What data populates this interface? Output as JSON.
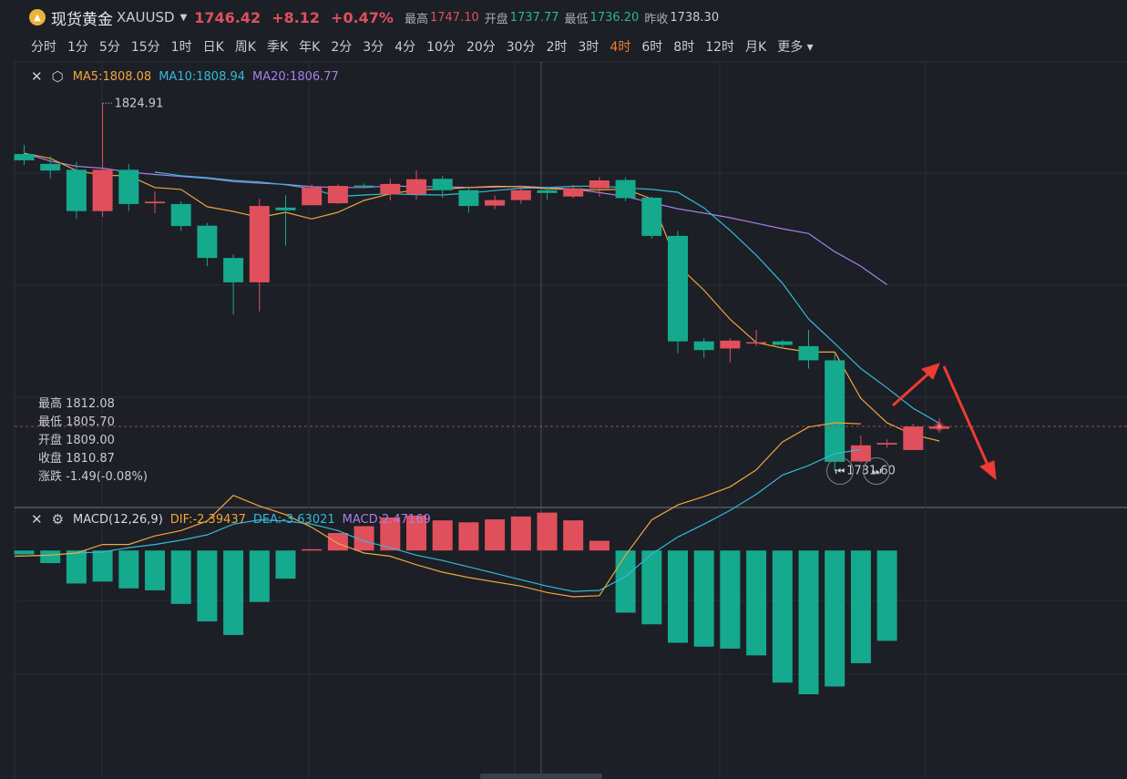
{
  "header": {
    "name": "现货黄金",
    "symbol": "XAUUSD",
    "price": "1746.42",
    "change": "+8.12",
    "change_pct": "+0.47%",
    "high_label": "最高",
    "high": "1747.10",
    "open_label": "开盘",
    "open": "1737.77",
    "low_label": "最低",
    "low": "1736.20",
    "prev_label": "昨收",
    "prev": "1738.30"
  },
  "periods": [
    "分时",
    "1分",
    "5分",
    "15分",
    "1时",
    "日K",
    "周K",
    "季K",
    "年K",
    "2分",
    "3分",
    "4分",
    "10分",
    "20分",
    "30分",
    "2时",
    "3时",
    "4时",
    "6时",
    "8时",
    "12时",
    "月K",
    "更多"
  ],
  "active_period": "4时",
  "legend": {
    "ma5": "MA5:1808.08",
    "ma10": "MA10:1808.94",
    "ma20": "MA20:1806.77",
    "macd_title": "MACD(12,26,9)",
    "dif": "DIF:-2.39437",
    "dea": "DEA:-3.63021",
    "macd": "MACD:2.47169"
  },
  "ohlc_info": {
    "high": "最高 1812.08",
    "low": "最低 1805.70",
    "open": "开盘 1809.00",
    "close": "收盘 1810.87",
    "change": "涨跌 -1.49(-0.08%)"
  },
  "colors": {
    "up": "#e0505c",
    "down": "#15a98e",
    "ma5": "#f2a43c",
    "ma10": "#35b9d6",
    "ma20": "#a77fe6",
    "arrow": "#ee3b34"
  },
  "icons": {
    "close": "close-icon",
    "settings": "gear-icon",
    "prev": "skip-back-icon",
    "next": "skip-forward-icon"
  },
  "chart_data": [
    {
      "type": "candlestick",
      "title": "",
      "ylim": [
        1726.6,
        1830.3
      ],
      "annotations": [
        {
          "text": "1824.91",
          "value": 1824.91,
          "index": 3
        },
        {
          "text": "1731.60",
          "value": 1731.6,
          "index": 31
        }
      ],
      "candles": [
        {
          "o": 1812.0,
          "c": 1810.4,
          "h": 1814.3,
          "l": 1809.2
        },
        {
          "o": 1809.5,
          "c": 1807.8,
          "h": 1811.5,
          "l": 1805.8
        },
        {
          "o": 1808.0,
          "c": 1797.5,
          "h": 1810.0,
          "l": 1795.5
        },
        {
          "o": 1797.5,
          "c": 1808.0,
          "h": 1824.91,
          "l": 1796.0
        },
        {
          "o": 1808.0,
          "c": 1799.3,
          "h": 1809.5,
          "l": 1797.5
        },
        {
          "o": 1799.5,
          "c": 1799.9,
          "h": 1802.5,
          "l": 1797.0
        },
        {
          "o": 1799.3,
          "c": 1793.7,
          "h": 1800.0,
          "l": 1792.5
        },
        {
          "o": 1793.8,
          "c": 1785.6,
          "h": 1794.5,
          "l": 1783.5
        },
        {
          "o": 1785.6,
          "c": 1779.4,
          "h": 1786.5,
          "l": 1771.2
        },
        {
          "o": 1779.4,
          "c": 1798.8,
          "h": 1800.6,
          "l": 1772.0
        },
        {
          "o": 1798.4,
          "c": 1797.7,
          "h": 1801.5,
          "l": 1788.7
        },
        {
          "o": 1799.0,
          "c": 1803.5,
          "h": 1804.3,
          "l": 1799.0
        },
        {
          "o": 1799.5,
          "c": 1803.9,
          "h": 1804.3,
          "l": 1799.3
        },
        {
          "o": 1804.0,
          "c": 1803.9,
          "h": 1804.5,
          "l": 1803.3
        },
        {
          "o": 1801.8,
          "c": 1804.4,
          "h": 1805.7,
          "l": 1800.2
        },
        {
          "o": 1801.8,
          "c": 1805.6,
          "h": 1807.9,
          "l": 1800.4
        },
        {
          "o": 1805.7,
          "c": 1802.8,
          "h": 1806.5,
          "l": 1800.9
        },
        {
          "o": 1802.8,
          "c": 1798.8,
          "h": 1803.5,
          "l": 1797.1
        },
        {
          "o": 1798.9,
          "c": 1800.3,
          "h": 1801.5,
          "l": 1798.0
        },
        {
          "o": 1800.3,
          "c": 1802.8,
          "h": 1804.0,
          "l": 1799.4
        },
        {
          "o": 1802.8,
          "c": 1802.1,
          "h": 1803.8,
          "l": 1800.4
        },
        {
          "o": 1801.2,
          "c": 1803.3,
          "h": 1804.2,
          "l": 1800.8
        },
        {
          "o": 1803.3,
          "c": 1805.3,
          "h": 1806.1,
          "l": 1801.2
        },
        {
          "o": 1805.4,
          "c": 1800.8,
          "h": 1806.1,
          "l": 1800.0
        },
        {
          "o": 1800.9,
          "c": 1791.2,
          "h": 1801.2,
          "l": 1790.5
        },
        {
          "o": 1791.2,
          "c": 1764.4,
          "h": 1792.5,
          "l": 1761.4
        },
        {
          "o": 1764.4,
          "c": 1762.2,
          "h": 1765.3,
          "l": 1760.2
        },
        {
          "o": 1762.6,
          "c": 1764.6,
          "h": 1765.2,
          "l": 1759.1
        },
        {
          "o": 1764.1,
          "c": 1764.2,
          "h": 1767.3,
          "l": 1763.2
        },
        {
          "o": 1764.4,
          "c": 1763.5,
          "h": 1764.8,
          "l": 1762.6
        },
        {
          "o": 1763.2,
          "c": 1759.6,
          "h": 1767.3,
          "l": 1757.5
        },
        {
          "o": 1759.6,
          "c": 1733.8,
          "h": 1761.5,
          "l": 1731.6
        },
        {
          "o": 1733.9,
          "c": 1738.0,
          "h": 1740.5,
          "l": 1733.6
        },
        {
          "o": 1738.2,
          "c": 1738.6,
          "h": 1739.5,
          "l": 1737.4
        },
        {
          "o": 1736.8,
          "c": 1742.8,
          "h": 1743.5,
          "l": 1737.4
        },
        {
          "o": 1742.2,
          "c": 1742.8,
          "h": 1744.8,
          "l": 1741.2
        }
      ],
      "ma5": [
        1812.2,
        1810.9,
        1807.8,
        1806.6,
        1806.5,
        1803.5,
        1803.0,
        1798.6,
        1797.4,
        1795.9,
        1797.2,
        1795.5,
        1797.2,
        1800.2,
        1801.9,
        1802.9,
        1803.1,
        1803.5,
        1803.8,
        1803.7,
        1803.2,
        1803.0,
        1802.9,
        1803.1,
        1800.6,
        1783.7,
        1777.4,
        1770.0,
        1764.1,
        1762.7,
        1761.7,
        1761.7,
        1749.9,
        1743.7,
        1740.7,
        1739.1
      ],
      "ma10": [
        null,
        null,
        null,
        1807.4,
        1806.5,
        1806.0,
        1805.3,
        1804.9,
        1804.2,
        1803.2,
        1801.2,
        1801.6,
        1801.9,
        1801.7,
        1801.6,
        1802.1,
        1802.7,
        1803.3,
        1803.5,
        1803.8,
        1803.9,
        1803.4,
        1803.0,
        1802.3,
        1798.3,
        1792.6,
        1786.3,
        1779.2,
        1770.1,
        1763.9,
        1757.5,
        1752.6,
        1747.4,
        1743.6
      ],
      "ma20": [
        1812.2,
        1810.2,
        1808.9,
        1808.4,
        1807.4,
        1806.8,
        1806.3,
        1805.8,
        1805.0,
        1804.6,
        1804.3,
        1803.7,
        1803.5,
        1803.5,
        1803.9,
        1803.7,
        1803.7,
        1803.5,
        1803.6,
        1803.8,
        1803.5,
        1803.1,
        1802.2,
        1801.2,
        1799.6,
        1798.1,
        1797.0,
        1795.8,
        1794.4,
        1793.0,
        1791.8,
        1787.2,
        1783.5,
        1778.8
      ],
      "ma_start_index": {
        "ma5": 0,
        "ma10": 2,
        "ma20": 0
      }
    },
    {
      "type": "bar+line",
      "title": "MACD(12,26,9)",
      "ylim": [
        -14.8,
        1.8
      ],
      "histogram": [
        -0.4,
        -1.3,
        -3.4,
        -3.2,
        -3.9,
        -4.1,
        -5.5,
        -7.3,
        -8.7,
        -5.3,
        -2.9,
        0.13,
        1.8,
        2.5,
        3.4,
        3.6,
        3.1,
        2.9,
        3.2,
        3.5,
        3.9,
        3.1,
        1.0,
        -6.4,
        -7.6,
        -9.5,
        -9.9,
        -10.1,
        -10.8,
        -13.6,
        -14.8,
        -14.0,
        -11.6,
        -9.3
      ],
      "dif": [
        -4.5,
        -4.6,
        -4.8,
        -5.6,
        -5.6,
        -6.4,
        -6.9,
        -7.8,
        -10.2,
        -9.2,
        -8.4,
        -7.2,
        -5.7,
        -4.8,
        -4.5,
        -3.7,
        -3.0,
        -2.5,
        -2.1,
        -1.7,
        -1.1,
        -0.7,
        -0.8,
        -4.6,
        -7.9,
        -9.3,
        -10.1,
        -11.0,
        -12.6,
        -15.2,
        -16.6,
        -17.0,
        -16.9
      ],
      "dea": [
        -4.5,
        -4.6,
        -4.8,
        -4.9,
        -5.3,
        -5.6,
        -6.0,
        -6.5,
        -7.5,
        -7.9,
        -7.8,
        -7.5,
        -6.9,
        -5.9,
        -5.3,
        -4.6,
        -4.1,
        -3.5,
        -2.9,
        -2.3,
        -1.7,
        -1.2,
        -1.3,
        -2.6,
        -4.7,
        -6.3,
        -7.5,
        -8.8,
        -10.3,
        -12.1,
        -13.0,
        -14.1,
        -14.5
      ]
    }
  ]
}
